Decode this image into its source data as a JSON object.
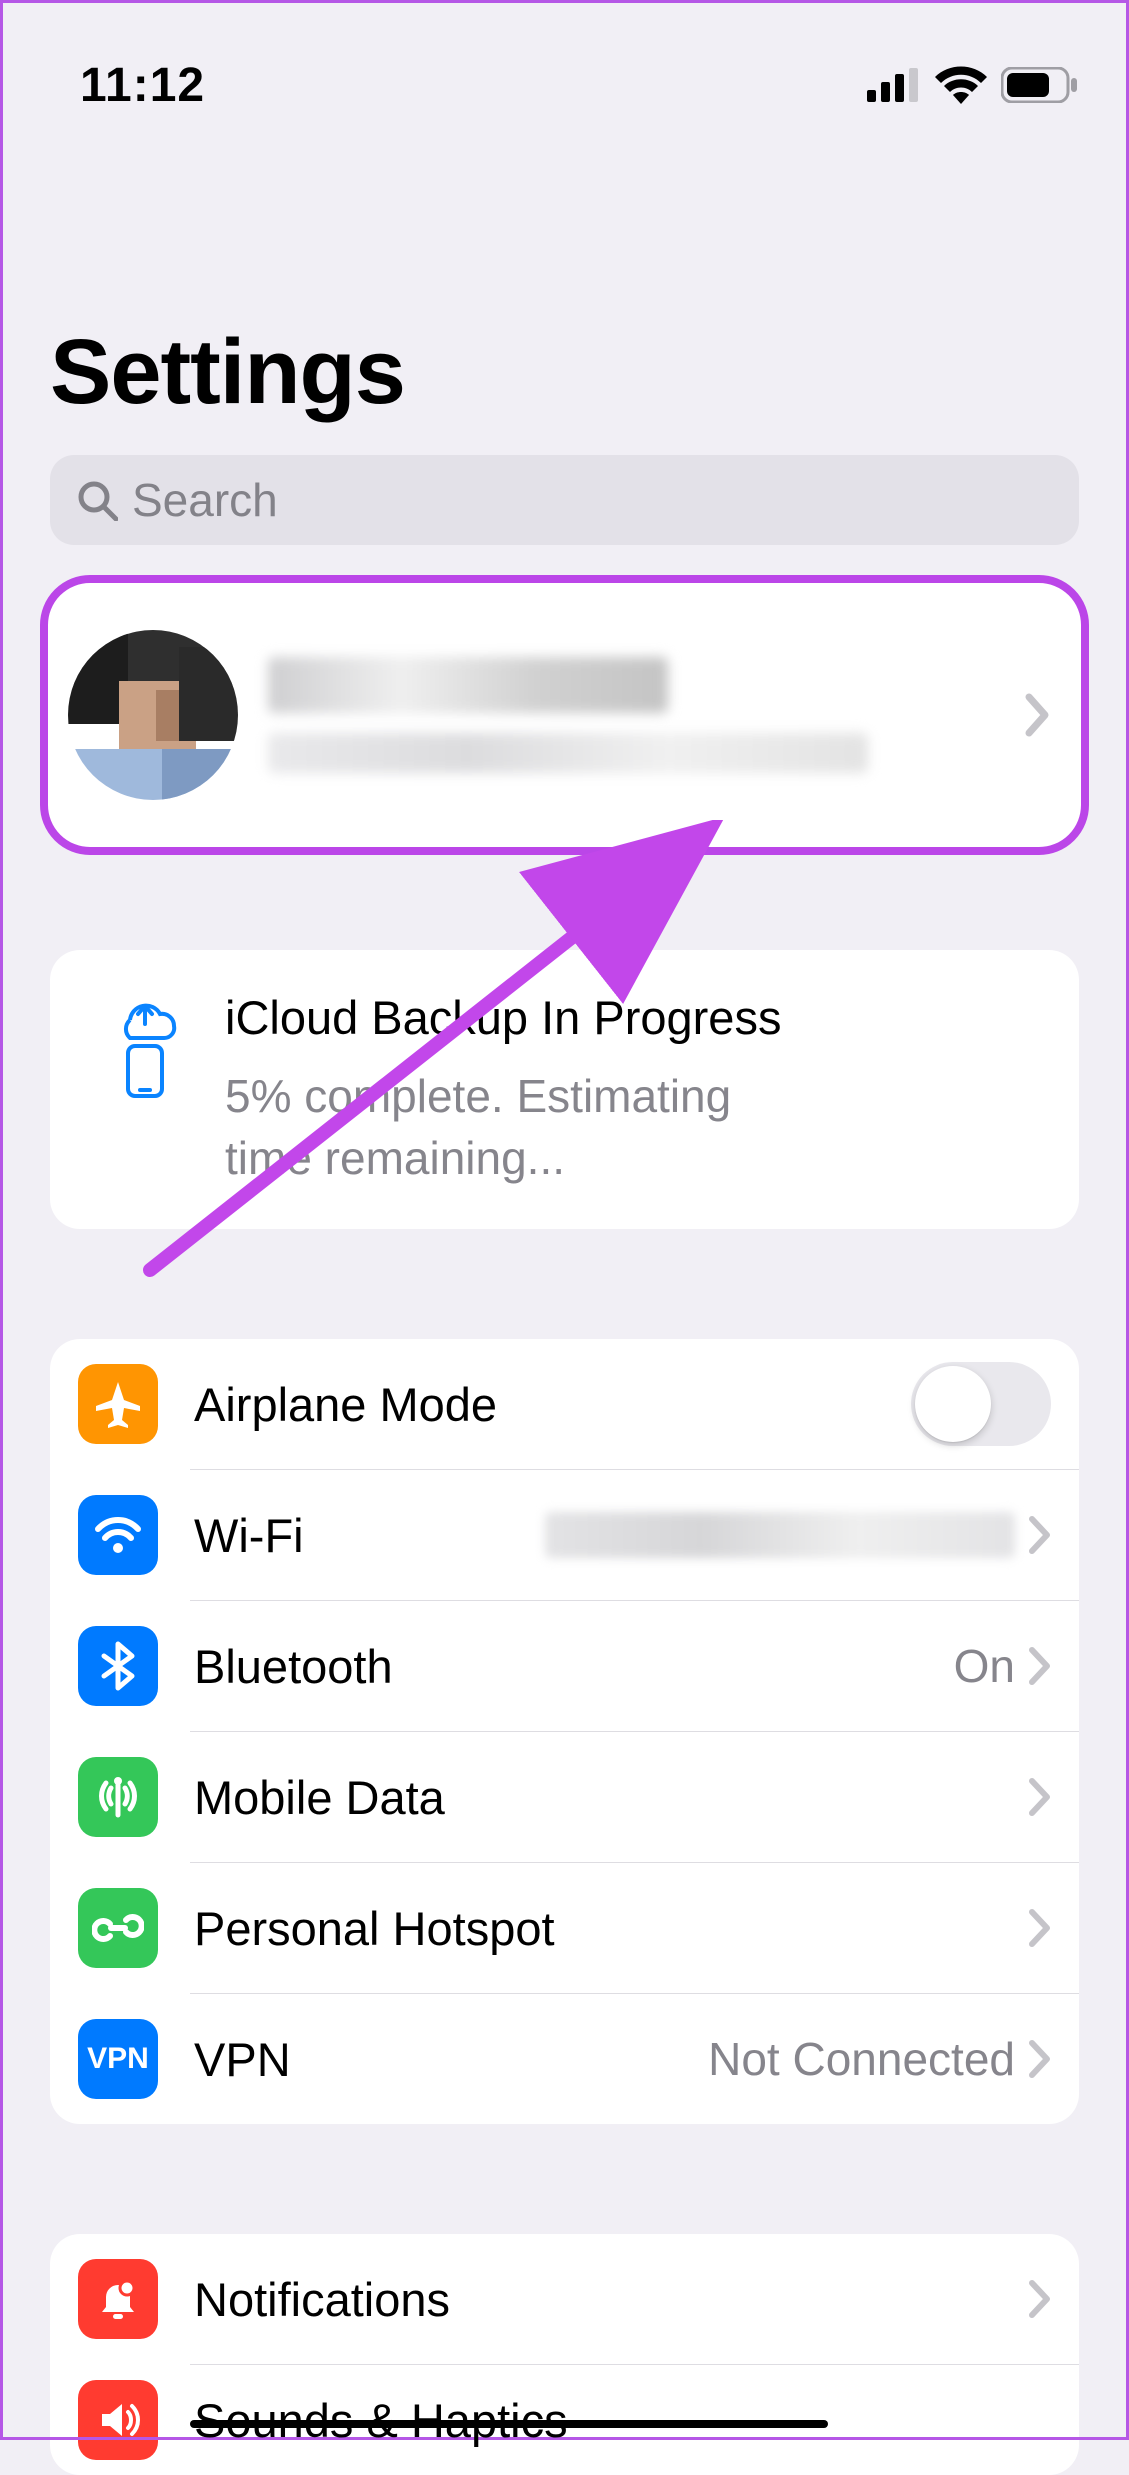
{
  "status": {
    "time": "11:12"
  },
  "title": "Settings",
  "search": {
    "placeholder": "Search"
  },
  "profile": {
    "name_redacted": true,
    "subtitle_redacted": true
  },
  "backup": {
    "title": "iCloud Backup In Progress",
    "subtitle": "5% complete. Estimating time remaining..."
  },
  "connectivity": {
    "airplane": {
      "label": "Airplane Mode",
      "on": false
    },
    "wifi": {
      "label": "Wi-Fi",
      "value_redacted": true
    },
    "bluetooth": {
      "label": "Bluetooth",
      "value": "On"
    },
    "mobile_data": {
      "label": "Mobile Data"
    },
    "hotspot": {
      "label": "Personal Hotspot"
    },
    "vpn": {
      "label": "VPN",
      "icon_text": "VPN",
      "value": "Not Connected"
    }
  },
  "alerts": {
    "notifications": {
      "label": "Notifications"
    },
    "sounds": {
      "label": "Sounds & Haptics"
    }
  },
  "annotation": {
    "highlight": "apple-id-row",
    "highlight_color": "#bb46e8"
  }
}
